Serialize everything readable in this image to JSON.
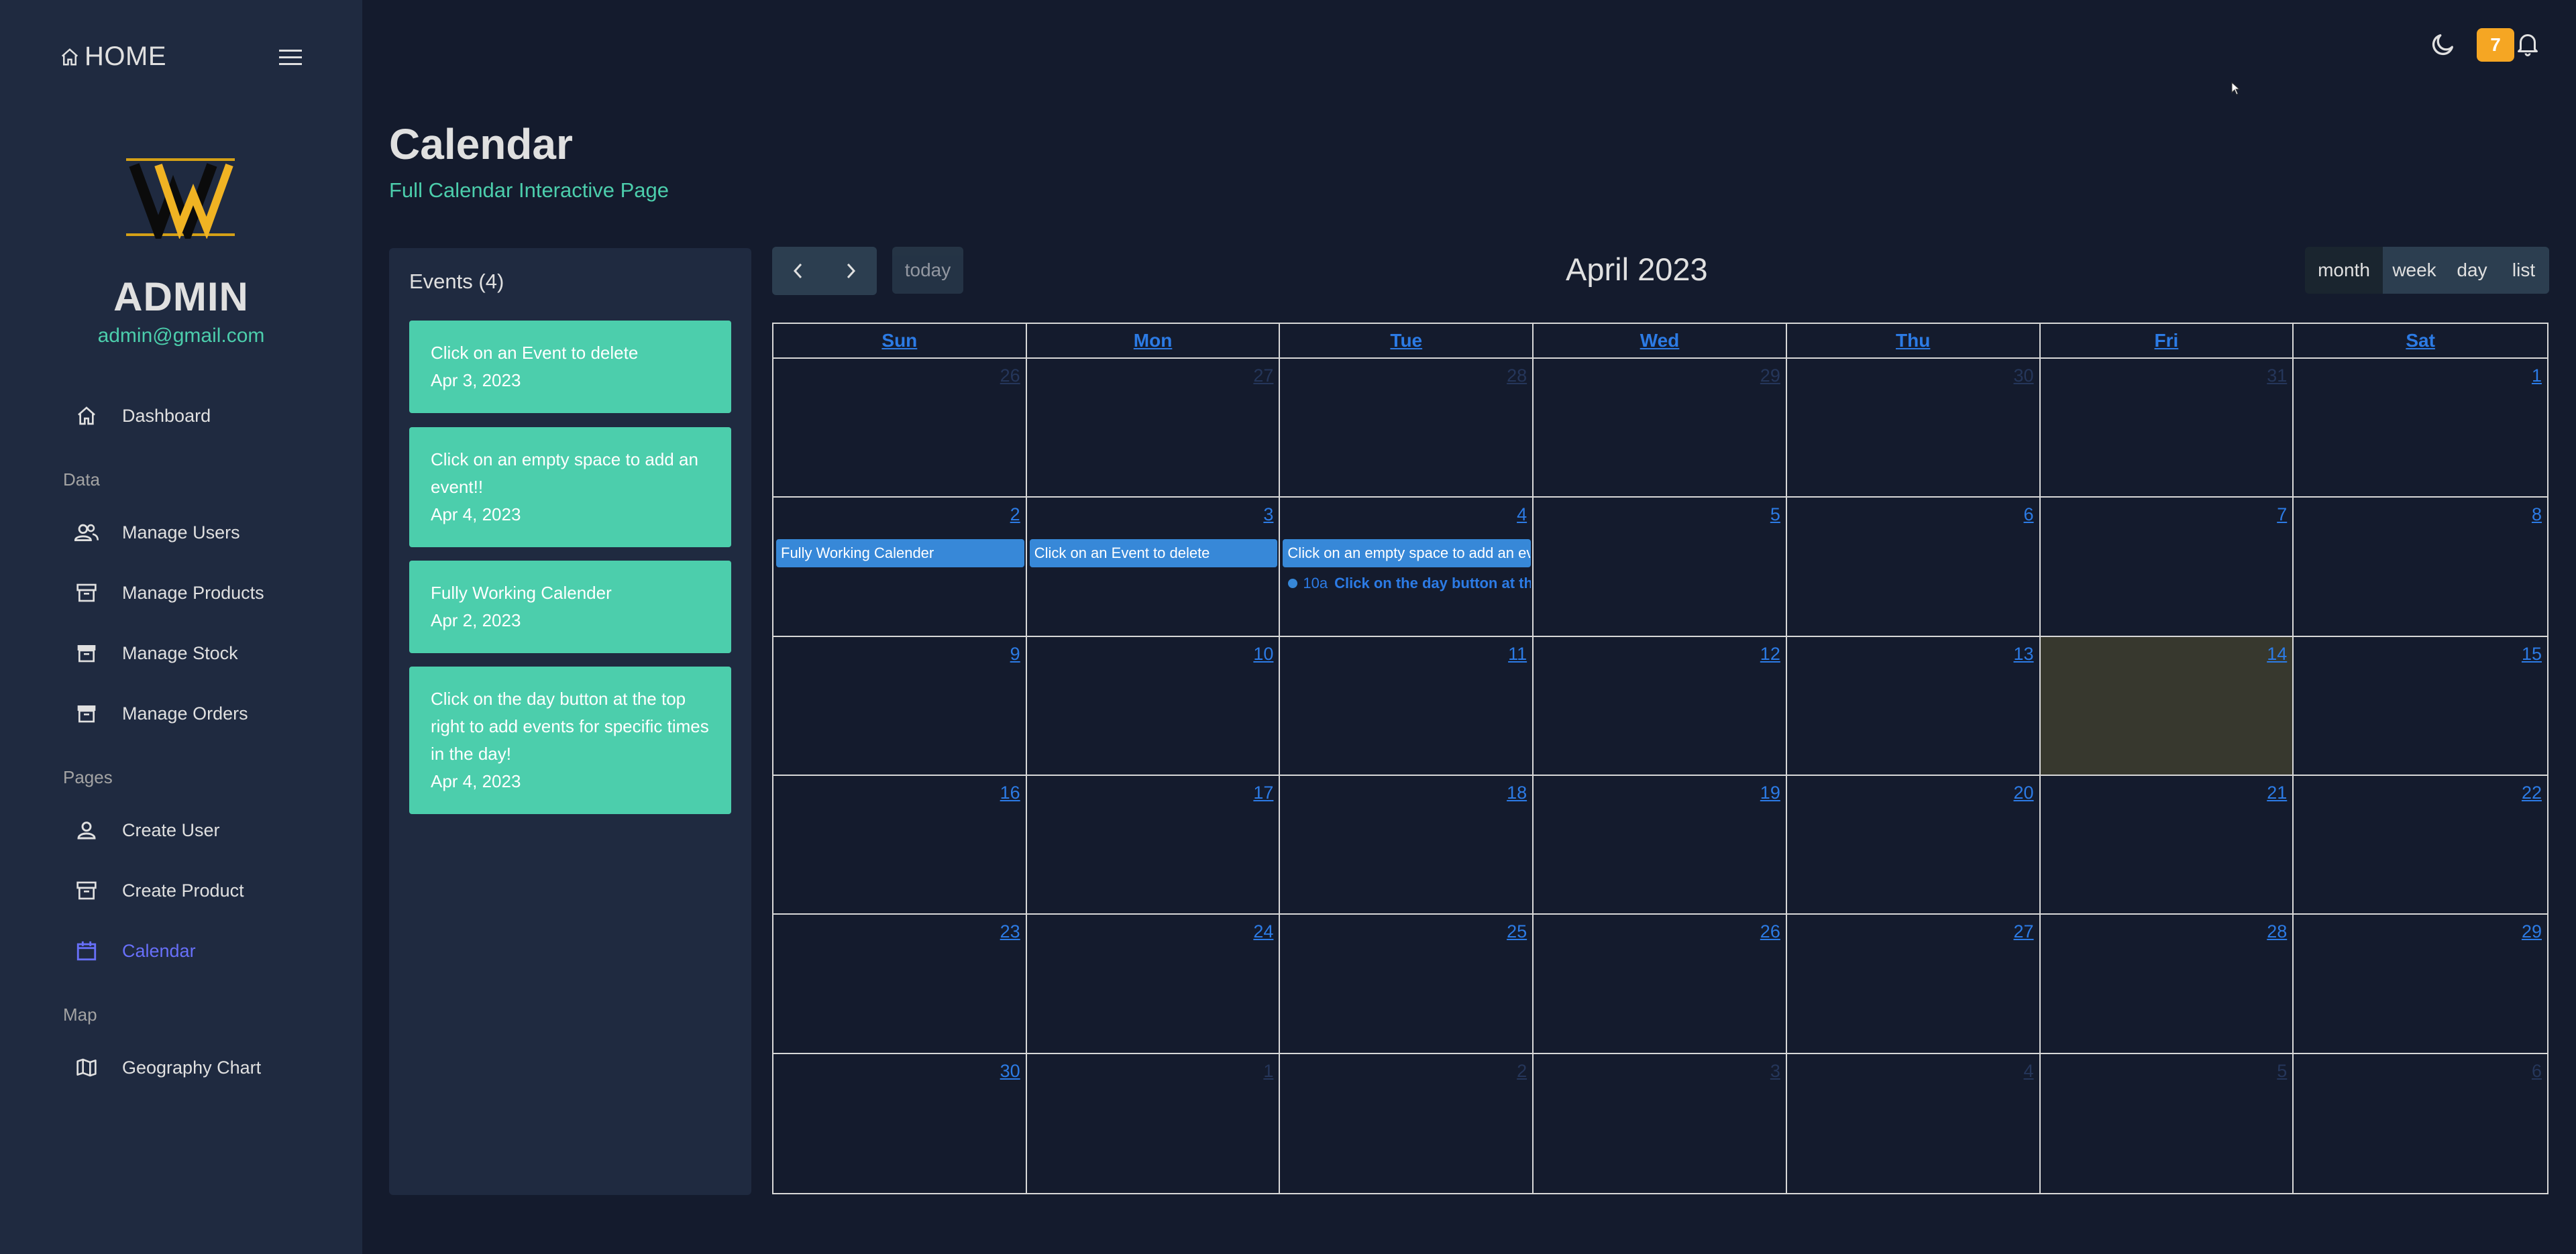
{
  "sidebar": {
    "home_label": "HOME",
    "admin_name": "ADMIN",
    "admin_email": "admin@gmail.com",
    "sections": {
      "data": "Data",
      "pages": "Pages",
      "map": "Map"
    },
    "items": [
      {
        "label": "Dashboard",
        "icon": "home-icon"
      },
      {
        "label": "Manage Users",
        "icon": "people-icon"
      },
      {
        "label": "Manage Products",
        "icon": "archive-icon"
      },
      {
        "label": "Manage Stock",
        "icon": "archive-icon"
      },
      {
        "label": "Manage Orders",
        "icon": "archive-icon"
      },
      {
        "label": "Create User",
        "icon": "person-icon"
      },
      {
        "label": "Create Product",
        "icon": "archive-icon"
      },
      {
        "label": "Calendar",
        "icon": "calendar-icon",
        "active": true
      },
      {
        "label": "Geography Chart",
        "icon": "map-icon"
      }
    ]
  },
  "topbar": {
    "notification_count": "7"
  },
  "header": {
    "title": "Calendar",
    "subtitle": "Full Calendar Interactive Page"
  },
  "events_panel": {
    "title": "Events (4)",
    "events": [
      {
        "title": "Click on an Event to delete",
        "date": "Apr 3, 2023"
      },
      {
        "title": "Click on an empty space to add an event!!",
        "date": "Apr 4, 2023"
      },
      {
        "title": "Fully Working Calender",
        "date": "Apr 2, 2023"
      },
      {
        "title": "Click on the day button at the top right to add events for specific times in the day!",
        "date": "Apr 4, 2023"
      }
    ]
  },
  "calendar": {
    "title": "April 2023",
    "today_label": "today",
    "views": [
      "month",
      "week",
      "day",
      "list"
    ],
    "active_view": "month",
    "weekdays": [
      "Sun",
      "Mon",
      "Tue",
      "Wed",
      "Thu",
      "Fri",
      "Sat"
    ],
    "weeks": [
      [
        "26",
        "27",
        "28",
        "29",
        "30",
        "31",
        "1"
      ],
      [
        "2",
        "3",
        "4",
        "5",
        "6",
        "7",
        "8"
      ],
      [
        "9",
        "10",
        "11",
        "12",
        "13",
        "14",
        "15"
      ],
      [
        "16",
        "17",
        "18",
        "19",
        "20",
        "21",
        "22"
      ],
      [
        "23",
        "24",
        "25",
        "26",
        "27",
        "28",
        "29"
      ],
      [
        "30",
        "1",
        "2",
        "3",
        "4",
        "5",
        "6"
      ]
    ],
    "grid_events": {
      "apr2": "Fully Working Calender",
      "apr3": "Click on an Event to delete",
      "apr4_allday": "Click on an empty space to add an event!!",
      "apr4_timed_time": "10a",
      "apr4_timed_title": "Click on the day button at the top right to add events for specific times in the day!"
    }
  },
  "colors": {
    "accent_green": "#4cceac",
    "event_blue": "#3788d8",
    "link_blue": "#2c7be5",
    "active_nav": "#6870fa",
    "badge": "#f5a623"
  }
}
